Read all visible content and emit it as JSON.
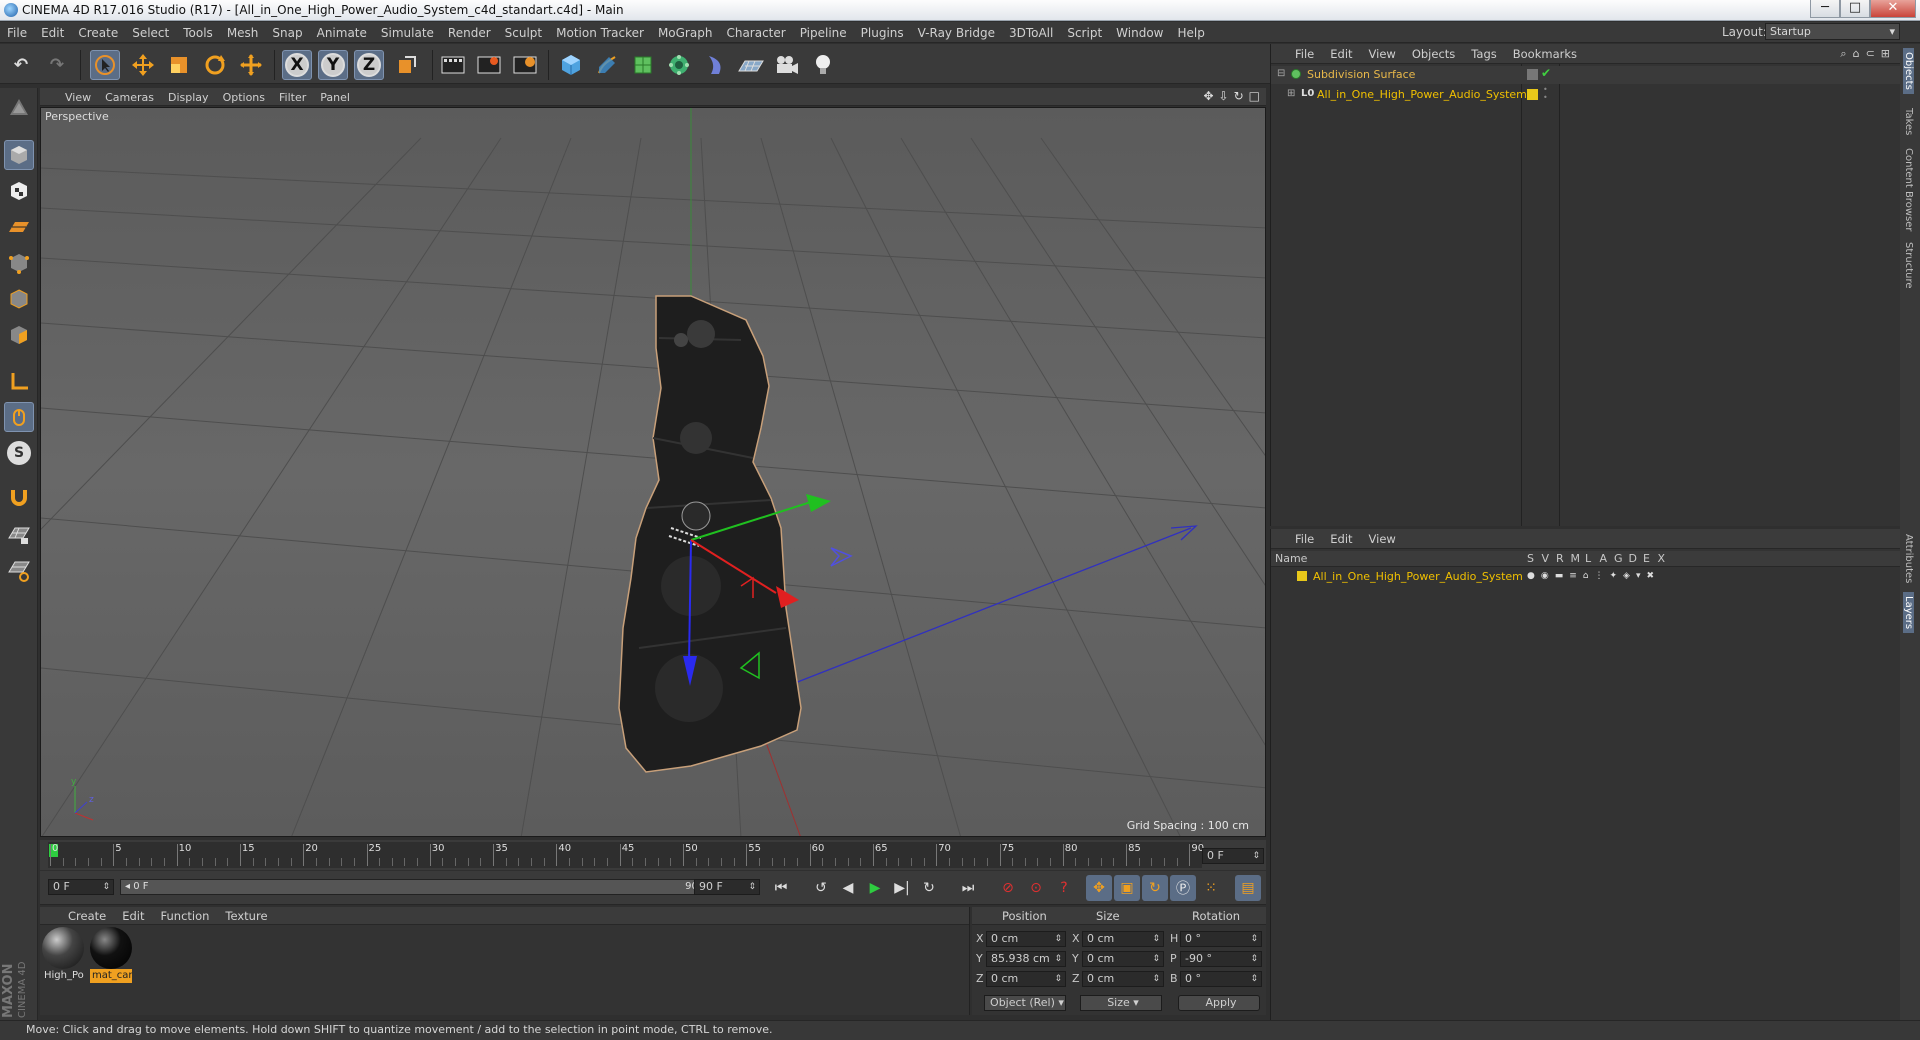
{
  "window": {
    "title": "CINEMA 4D R17.016 Studio (R17) - [All_in_One_High_Power_Audio_System_c4d_standart.c4d] - Main",
    "minimize": "─",
    "maximize": "□",
    "close": "✕"
  },
  "menubar": {
    "items": [
      "File",
      "Edit",
      "Create",
      "Select",
      "Tools",
      "Mesh",
      "Snap",
      "Animate",
      "Simulate",
      "Render",
      "Sculpt",
      "Motion Tracker",
      "MoGraph",
      "Character",
      "Pipeline",
      "Plugins",
      "V-Ray Bridge",
      "3DToAll",
      "Script",
      "Window",
      "Help"
    ],
    "layout_label": "Layout:",
    "layout_value": "Startup"
  },
  "toolbar": {
    "undo": "↶",
    "redo": "↷",
    "axis_x": "X",
    "axis_y": "Y",
    "axis_z": "Z",
    "icons": [
      "undo-icon",
      "redo-icon",
      "select-icon",
      "move-icon",
      "scale-icon",
      "rotate-icon",
      "transform-icon",
      "lock-x-icon",
      "lock-y-icon",
      "lock-z-icon",
      "world-coords-icon",
      "render-view-icon",
      "render-picture-viewer-icon",
      "edit-render-settings-icon",
      "cube-icon",
      "pen-icon",
      "subdivision-icon",
      "cloner-icon",
      "deformer-icon",
      "floor-icon",
      "camera-icon",
      "light-icon"
    ]
  },
  "viewport": {
    "menu": [
      "View",
      "Cameras",
      "Display",
      "Options",
      "Filter",
      "Panel"
    ],
    "label": "Perspective",
    "grid_spacing": "Grid Spacing : 100 cm"
  },
  "timeline": {
    "ticks": [
      "0",
      "5",
      "10",
      "15",
      "20",
      "25",
      "30",
      "35",
      "40",
      "45",
      "50",
      "55",
      "60",
      "65",
      "70",
      "75",
      "80",
      "85",
      "90"
    ],
    "current_frame": "0 F"
  },
  "transport": {
    "start_field": "0 F",
    "range_start": "◂ 0 F",
    "range_end": "90 F ▸",
    "end_field": "90 F"
  },
  "material_manager": {
    "menu": [
      "Create",
      "Edit",
      "Function",
      "Texture"
    ],
    "materials": [
      {
        "name": "High_Po",
        "selected": false
      },
      {
        "name": "mat_car",
        "selected": true
      }
    ]
  },
  "coordinates": {
    "headers": [
      "Position",
      "Size",
      "Rotation"
    ],
    "rows": [
      {
        "axis": "X",
        "pos": "0 cm",
        "size_axis": "X",
        "size": "0 cm",
        "rot_axis": "H",
        "rot": "0 °"
      },
      {
        "axis": "Y",
        "pos": "85.938 cm",
        "size_axis": "Y",
        "size": "0 cm",
        "rot_axis": "P",
        "rot": "-90 °"
      },
      {
        "axis": "Z",
        "pos": "0 cm",
        "size_axis": "Z",
        "size": "0 cm",
        "rot_axis": "B",
        "rot": "0 °"
      }
    ],
    "mode_select": "Object (Rel)",
    "size_select": "Size",
    "apply": "Apply"
  },
  "object_manager": {
    "menu": [
      "File",
      "Edit",
      "View",
      "Objects",
      "Tags",
      "Bookmarks"
    ],
    "objects": [
      {
        "name": "Subdivision Surface",
        "color": "#e8b84a"
      },
      {
        "name": "All_in_One_High_Power_Audio_System",
        "color": "#f0c000"
      }
    ]
  },
  "layer_manager": {
    "menu": [
      "File",
      "Edit",
      "View"
    ],
    "col_name": "Name",
    "cols": [
      "S",
      "V",
      "R",
      "M",
      "L",
      "A",
      "G",
      "D",
      "E",
      "X"
    ],
    "layers": [
      {
        "name": "All_in_One_High_Power_Audio_System",
        "color": "#e8c81a"
      }
    ]
  },
  "right_tabs": {
    "top": [
      "Objects",
      "Takes",
      "Content Browser",
      "Structure"
    ],
    "bottom": [
      "Attributes",
      "Layers"
    ]
  },
  "logo": {
    "line1": "MAXON",
    "line2": "CINEMA 4D"
  },
  "status": "Move: Click and drag to move elements. Hold down SHIFT to quantize movement / add to the selection in point mode, CTRL to remove."
}
